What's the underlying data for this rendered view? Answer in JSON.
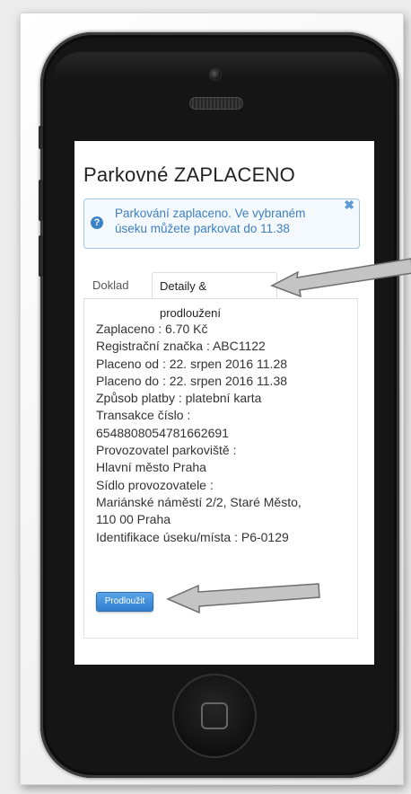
{
  "page": {
    "title": "Parkovné ZAPLACENO"
  },
  "alert": {
    "icon": "question-circle-icon",
    "text": "Parkování zaplaceno. Ve vybraném úseku můžete parkovat do 11.38",
    "close_icon": "close-icon",
    "close_glyph": "✖"
  },
  "tabs": [
    {
      "label": "Doklad",
      "active": false
    },
    {
      "label": "Detaily & prodloužení",
      "active": true
    }
  ],
  "details": {
    "lines": [
      "Zaplaceno :  6.70 Kč",
      "Registrační značka :  ABC1122",
      "Placeno od :  22. srpen 2016 11.28",
      "Placeno do :  22. srpen 2016 11.38",
      "Způsob platby :  platební karta",
      "Transakce číslo :",
      "6548808054781662691",
      "Provozovatel parkoviště :",
      "Hlavní město Praha",
      "Sídlo provozovatele :",
      "Mariánské náměstí 2/2, Staré Město,",
      "110 00 Praha",
      "Identifikace úseku/místa :  P6-0129"
    ]
  },
  "extend_button": {
    "label": "Prodloužit"
  },
  "colors": {
    "alert_text": "#3d7fbf",
    "button": "#2f7fcf",
    "phone_body": "#151515",
    "arrow": "#bdbdbd"
  }
}
